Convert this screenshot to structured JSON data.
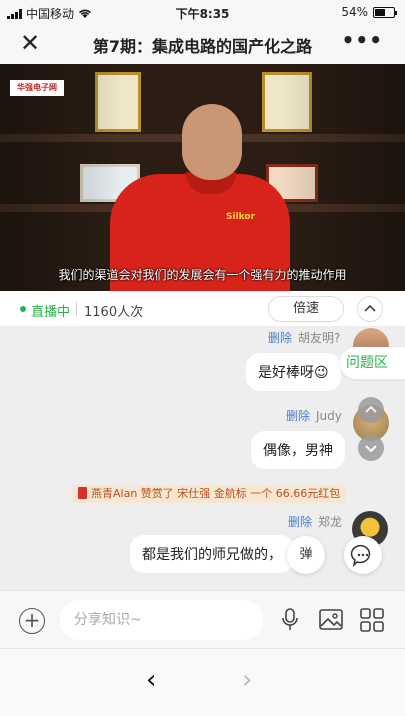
{
  "status": {
    "carrier": "中国移动",
    "time": "下午8:35",
    "battery_text": "54%",
    "battery_level": 0.54
  },
  "nav": {
    "close": "✕",
    "title": "第7期：集成电路的国产化之路",
    "more": "•••"
  },
  "video": {
    "logo": "华强电子网",
    "subtitle": "我们的渠道会对我们的发展会有一个强有力的推动作用",
    "shirt_brand": "Silkor"
  },
  "live": {
    "status": "直播中",
    "viewers": "1160人次",
    "speed_label": "倍速"
  },
  "chat": {
    "qa_tab": "问题区",
    "messages": [
      {
        "delete": "删除",
        "user": "胡友明?",
        "text": "是好棒呀😉"
      },
      {
        "delete": "删除",
        "user": "Judy",
        "text": "偶像，男神"
      },
      {
        "delete": "删除",
        "user": "郑龙",
        "text": "都是我们的师兄做的，"
      }
    ],
    "gift": "燕青Alan 赞赏了 宋仕强 金航标 一个 66.66元红包",
    "fab_label": "弹"
  },
  "input": {
    "placeholder": "分享知识~"
  },
  "browser": {
    "back": "‹",
    "forward": "›"
  },
  "colors": {
    "accent_green": "#2ab14a",
    "link_blue": "#4a7fc9"
  }
}
